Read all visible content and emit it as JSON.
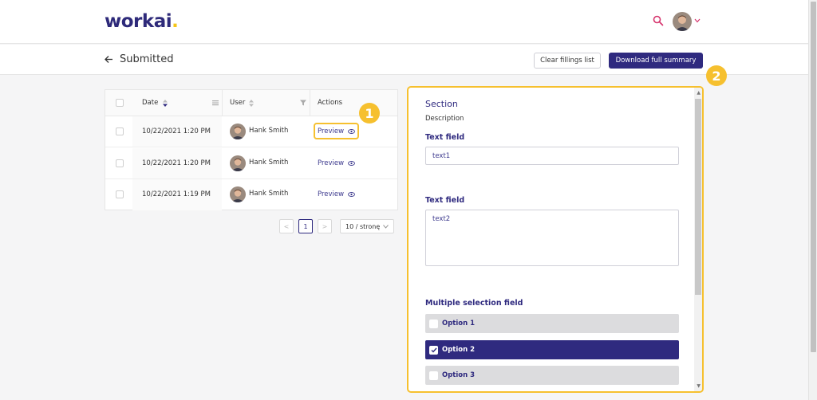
{
  "header": {
    "logo_text": "workai",
    "logo_dot": ".",
    "brand_color": "#2e2a7a",
    "accent_color": "#f5c518"
  },
  "subheader": {
    "title": "Submitted",
    "clear_button": "Clear fillings list",
    "download_button": "Download full summary"
  },
  "markers": [
    "1",
    "2"
  ],
  "table": {
    "columns": {
      "date": "Date",
      "user": "User",
      "actions": "Actions"
    },
    "rows": [
      {
        "date": "10/22/2021 1:20 PM",
        "user": "Hank Smith",
        "action": "Preview"
      },
      {
        "date": "10/22/2021 1:20 PM",
        "user": "Hank Smith",
        "action": "Preview"
      },
      {
        "date": "10/22/2021 1:19 PM",
        "user": "Hank Smith",
        "action": "Preview"
      }
    ]
  },
  "pagination": {
    "prev": "<",
    "current": "1",
    "next": ">",
    "page_size": "10 / stronę"
  },
  "panel": {
    "section_title": "Section",
    "description": "Description",
    "text_field_1": {
      "label": "Text field",
      "value": "text1"
    },
    "text_field_2": {
      "label": "Text field",
      "value": "text2"
    },
    "multi_select": {
      "label": "Multiple selection field",
      "options": [
        {
          "label": "Option 1",
          "checked": false
        },
        {
          "label": "Option 2",
          "checked": true
        },
        {
          "label": "Option 3",
          "checked": false
        }
      ]
    }
  }
}
